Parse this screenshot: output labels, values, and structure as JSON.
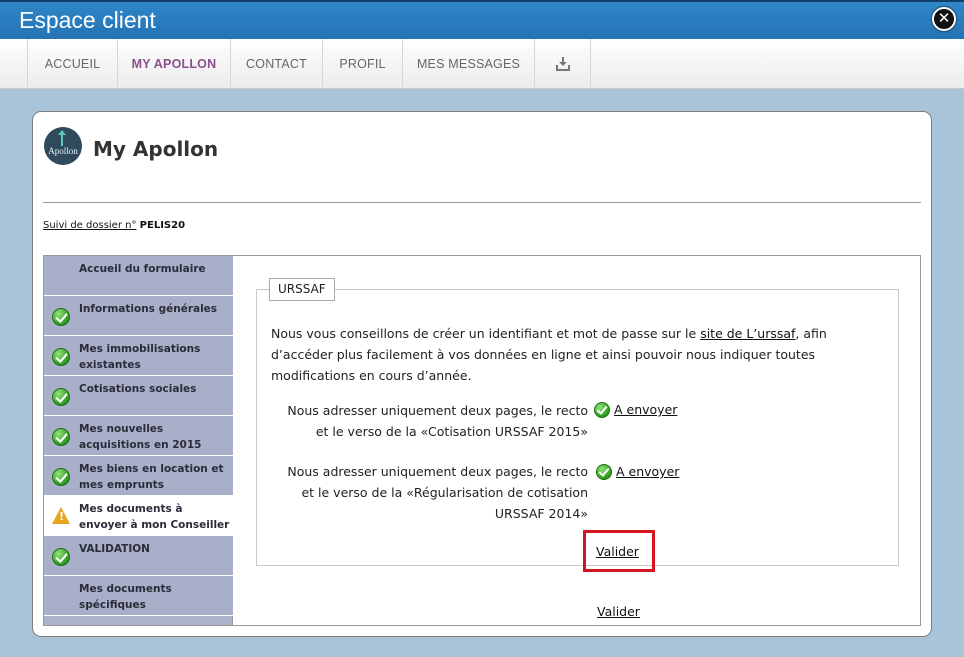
{
  "window": {
    "title": "Espace client"
  },
  "nav": {
    "items": [
      {
        "label": "ACCUEIL",
        "active": false
      },
      {
        "label": "MY APOLLON",
        "active": true
      },
      {
        "label": "CONTACT",
        "active": false
      },
      {
        "label": "PROFIL",
        "active": false
      },
      {
        "label": "MES MESSAGES",
        "active": false
      }
    ],
    "download_icon": "download-icon"
  },
  "page": {
    "logo_text": "Apollon",
    "title": "My Apollon",
    "dossier_label": "Suivi de dossier n°",
    "dossier_number": "PELIS20"
  },
  "sidebar": {
    "items": [
      {
        "label": "Accueil du formulaire",
        "status": "none"
      },
      {
        "label": "Informations générales",
        "status": "done"
      },
      {
        "label": "Mes immobilisations existantes",
        "status": "done"
      },
      {
        "label": "Cotisations sociales",
        "status": "done"
      },
      {
        "label": "Mes nouvelles acquisitions en 2015",
        "status": "done"
      },
      {
        "label": "Mes biens en location et mes emprunts",
        "status": "done"
      },
      {
        "label": "Mes documents à envoyer à mon Conseiller",
        "status": "warning"
      },
      {
        "label": "VALIDATION",
        "status": "done"
      },
      {
        "label": "Mes documents spécifiques",
        "status": "none"
      }
    ]
  },
  "form": {
    "legend": "URSSAF",
    "intro_before": "Nous vous conseillons de créer un identifiant et mot de passe sur le ",
    "intro_link": "site de L’urssaf",
    "intro_after": ", afin d’accéder plus facilement à vos données en ligne et ainsi pouvoir nous indiquer toutes modifications en cours d’année.",
    "requests": [
      {
        "line1": "Nous adresser uniquement deux pages, le recto",
        "line2": "et le verso de la «Cotisation URSSAF 2015»",
        "line3": "",
        "action": "A envoyer"
      },
      {
        "line1": "Nous adresser uniquement deux pages, le recto",
        "line2": "et le verso de la «Régularisation de cotisation",
        "line3": "URSSAF 2014»",
        "action": "A envoyer"
      }
    ],
    "validate_inner": "Valider",
    "validate_outer": "Valider"
  },
  "colors": {
    "titlebar": "#2473b5",
    "nav_active": "#8a4f8c",
    "sidebar": "#a7b0c8",
    "highlight": "#d3131d"
  }
}
